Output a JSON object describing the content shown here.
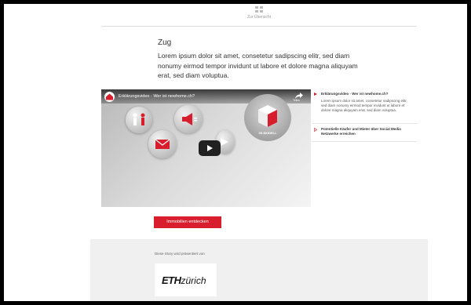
{
  "nav": {
    "overview_label": "Zur Übersicht",
    "icon": "grid-icon"
  },
  "story": {
    "title": "Zug",
    "lead": "Lorem ipsum dolor sit amet, consetetur sadipscing elitr, sed diam nonumy eirmod tempor invidunt ut labore et dolore magna aliquyam erat, sed diam voluptua."
  },
  "video": {
    "title": "Erklärungsvideo - Wer ist newhome.ch?",
    "share_label": "Teilen",
    "model_label": "3S-MODELL",
    "icons": [
      "people-icon",
      "megaphone-icon",
      "mail-icon",
      "arrow-icon",
      "cube-icon",
      "play-icon"
    ]
  },
  "playlist": {
    "items": [
      {
        "title": "Erklärungsvideo - Wer ist newhome.ch?",
        "description": "Lorem ipsum dolor sit amet, consetetur sadipscing elitr, sed diam nonumy eirmod tempor invidunt ut labore et dolore magna aliquyam erat, sed diam voluptua."
      },
      {
        "title": "Potentielle Käufer und Mieter über Social Media Netzwerke erreichen",
        "description": ""
      }
    ]
  },
  "cta": {
    "label": "Immobilien entdecken"
  },
  "footer": {
    "presented_by": "Diese Story wird präsentiert von",
    "sponsor_bold": "ETH",
    "sponsor_light": "zürich"
  },
  "colors": {
    "accent": "#d81e2c",
    "footer_bg": "#f0f0f0",
    "text": "#333333"
  }
}
